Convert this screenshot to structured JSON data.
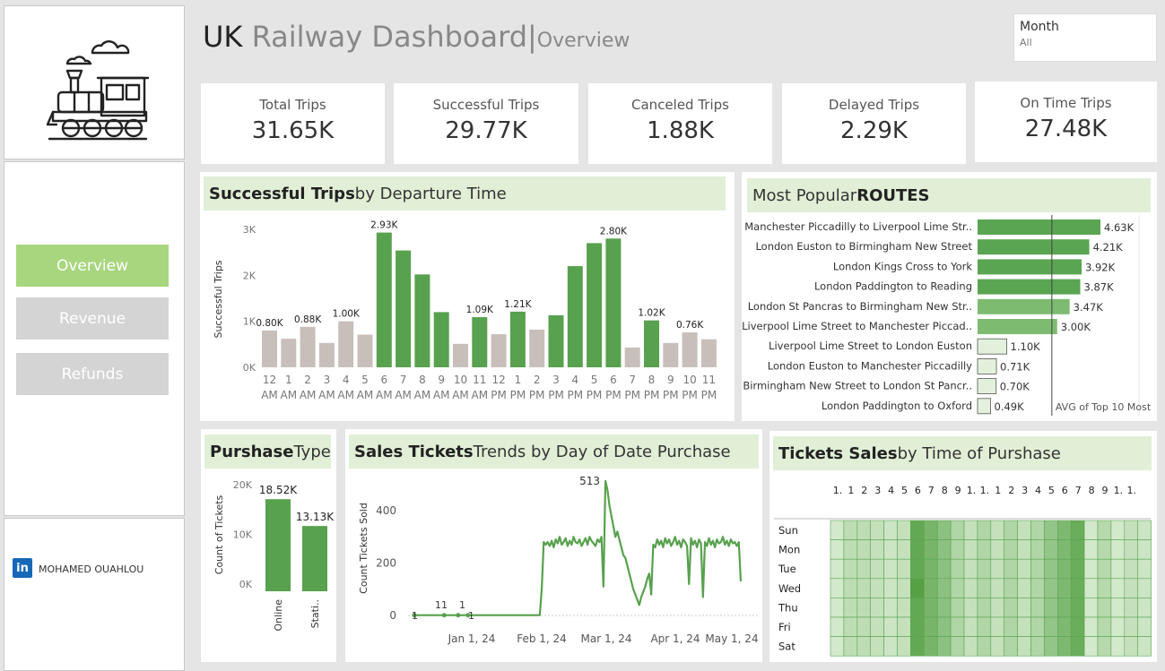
{
  "header": {
    "title_bold": "UK",
    "title_rest": " Railway Dashboard",
    "separator": "|",
    "subtitle": "Overview"
  },
  "filter": {
    "label": "Month",
    "value": "All"
  },
  "nav": [
    {
      "label": "Overview",
      "active": true
    },
    {
      "label": "Revenue",
      "active": false
    },
    {
      "label": "Refunds",
      "active": false
    }
  ],
  "credit": {
    "icon": "linkedin-icon",
    "icon_text": "in",
    "name": "MOHAMED OUAHLOU"
  },
  "kpis": [
    {
      "label": "Total Trips",
      "value": "31.65K"
    },
    {
      "label": "Successful Trips",
      "value": "29.77K"
    },
    {
      "label": "Canceled Trips",
      "value": "1.88K"
    },
    {
      "label": "Delayed Trips",
      "value": "2.29K"
    },
    {
      "label": "On Time Trips",
      "value": "27.48K"
    }
  ],
  "panels": {
    "departure": {
      "title_bold": "Successful Trips",
      "title_rest": " by Departure Time"
    },
    "routes": {
      "title_rest": "Most Popular ",
      "title_bold": "ROUTES"
    },
    "purchase_type": {
      "title_bold": "Purshase",
      "title_rest": " Type"
    },
    "sales_trend": {
      "title_bold": "Sales Tickets",
      "title_rest": " Trends by Day of Date Purchase"
    },
    "time_sales": {
      "title_bold": "Tickets Sales",
      "title_rest": " by Time of Purshase"
    }
  },
  "colors": {
    "accent": "#a8d67e",
    "bar_green": "#58a14e",
    "bar_gray": "#c8bfbb",
    "title_bg": "#e1efd6"
  },
  "chart_data": [
    {
      "id": "departure",
      "type": "bar",
      "ylabel": "Successful Trips",
      "ylim": [
        0,
        3200
      ],
      "yticks": [
        "0K",
        "1K",
        "2K",
        "3K"
      ],
      "categories": [
        "12 AM",
        "1 AM",
        "2 AM",
        "3 AM",
        "4 AM",
        "5 AM",
        "6 AM",
        "7 AM",
        "8 AM",
        "9 AM",
        "10 AM",
        "11 AM",
        "12 PM",
        "1 PM",
        "2 PM",
        "3 PM",
        "4 PM",
        "5 PM",
        "6 PM",
        "7 PM",
        "8 PM",
        "9 PM",
        "10 PM",
        "11 PM"
      ],
      "hour_labels": [
        "12",
        "1",
        "2",
        "3",
        "4",
        "5",
        "6",
        "7",
        "8",
        "9",
        "10",
        "11",
        "12",
        "1",
        "2",
        "3",
        "4",
        "5",
        "6",
        "7",
        "8",
        "9",
        "10",
        "11"
      ],
      "ampm_labels": [
        "AM",
        "AM",
        "AM",
        "AM",
        "AM",
        "AM",
        "AM",
        "AM",
        "AM",
        "AM",
        "AM",
        "AM",
        "PM",
        "PM",
        "PM",
        "PM",
        "PM",
        "PM",
        "PM",
        "PM",
        "PM",
        "PM",
        "PM",
        "PM"
      ],
      "values": [
        800,
        620,
        880,
        530,
        1000,
        710,
        2930,
        2540,
        2020,
        1200,
        510,
        1090,
        720,
        1210,
        820,
        1130,
        2200,
        2700,
        2800,
        430,
        1020,
        530,
        760,
        610
      ],
      "highlight": [
        false,
        false,
        false,
        false,
        false,
        false,
        true,
        true,
        true,
        true,
        false,
        true,
        false,
        true,
        false,
        true,
        true,
        true,
        true,
        false,
        true,
        false,
        false,
        false
      ],
      "data_labels": [
        "0.80K",
        "",
        "0.88K",
        "",
        "1.00K",
        "",
        "2.93K",
        "",
        "",
        "",
        "",
        "1.09K",
        "",
        "1.21K",
        "",
        "",
        "",
        "",
        "2.80K",
        "",
        "1.02K",
        "",
        "0.76K",
        ""
      ]
    },
    {
      "id": "routes",
      "type": "bar",
      "orientation": "horizontal",
      "categories": [
        "Manchester Piccadilly to Liverpool Lime Str..",
        "London Euston to Birmingham New Street",
        "London Kings Cross to York",
        "London Paddington to Reading",
        "London St Pancras to Birmingham New Str..",
        "Liverpool Lime Street to Manchester Piccad..",
        "Liverpool Lime Street to London Euston",
        "London Euston to Manchester Piccadilly",
        "Birmingham New Street to London St Pancr..",
        "London Paddington to Oxford"
      ],
      "values": [
        4630,
        4210,
        3920,
        3870,
        3470,
        3000,
        1100,
        710,
        700,
        490
      ],
      "data_labels": [
        "4.63K",
        "4.21K",
        "3.92K",
        "3.87K",
        "3.47K",
        "3.00K",
        "1.10K",
        "0.71K",
        "0.70K",
        "0.49K"
      ],
      "reference_line": {
        "label": "AVG of Top 10 Most",
        "value": 2800
      },
      "xlim": [
        0,
        5000
      ]
    },
    {
      "id": "purchase_type",
      "type": "bar",
      "ylabel": "Count of Tickets",
      "ylim": [
        0,
        21000
      ],
      "yticks": [
        "0K",
        "10K",
        "20K"
      ],
      "categories": [
        "Online",
        "Stati.."
      ],
      "values": [
        18520,
        13130
      ],
      "data_labels": [
        "18.52K",
        "13.13K"
      ]
    },
    {
      "id": "sales_trend",
      "type": "line",
      "ylabel": "Count Tickets Sold",
      "ylim": [
        0,
        550
      ],
      "yticks": [
        "0",
        "200",
        "400"
      ],
      "xticks": [
        "Jan 1, 24",
        "Feb 1, 24",
        "Mar 1, 24",
        "Apr 1, 24",
        "May 1, 24"
      ],
      "annotations": [
        "1",
        "11",
        "1",
        "1",
        "513"
      ],
      "series": [
        {
          "values": [
            1,
            1,
            1,
            1,
            1,
            1,
            1,
            1,
            1,
            1,
            1,
            1,
            1,
            1,
            1,
            1,
            1,
            1,
            1,
            1,
            1,
            1,
            1,
            1,
            1,
            1,
            1,
            1,
            1,
            1,
            1,
            1,
            1,
            1,
            1,
            1,
            1,
            1,
            1,
            1,
            1,
            1,
            1,
            1,
            1,
            1,
            1,
            1,
            1,
            1,
            1,
            1,
            1,
            1,
            1,
            1,
            1,
            1,
            1,
            1,
            1,
            1,
            1,
            1,
            100,
            280,
            270,
            280,
            265,
            285,
            260,
            290,
            275,
            300,
            270,
            280,
            295,
            265,
            285,
            270,
            300,
            280,
            275,
            290,
            265,
            280,
            295,
            270,
            300,
            285,
            275,
            265,
            290,
            280,
            300,
            110,
            513,
            480,
            420,
            380,
            340,
            300,
            320,
            290,
            260,
            230,
            220,
            190,
            160,
            130,
            100,
            80,
            60,
            40,
            70,
            90,
            110,
            140,
            160,
            80,
            270,
            260,
            290,
            270,
            285,
            260,
            295,
            275,
            290,
            265,
            280,
            300,
            270,
            285,
            260,
            290,
            280,
            265,
            120,
            295,
            270,
            285,
            260,
            290,
            275,
            70,
            280,
            265,
            295,
            270,
            285,
            260,
            290,
            275,
            280,
            300,
            270,
            285,
            265,
            290,
            275,
            280,
            265,
            280,
            130
          ]
        }
      ]
    },
    {
      "id": "time_sales",
      "type": "heatmap",
      "rows": [
        "Sun",
        "Mon",
        "Tue",
        "Wed",
        "Thu",
        "Fri",
        "Sat"
      ],
      "col_labels": [
        "1.",
        "1",
        "2",
        "3",
        "4",
        "5",
        "6",
        "7",
        "8",
        "9",
        "1.",
        "1.",
        "1",
        "2",
        "3",
        "4",
        "5",
        "6",
        "7",
        "8",
        "9",
        "1.",
        "1."
      ],
      "col_intensity": [
        0.1,
        0.25,
        0.25,
        0.2,
        0.15,
        0.2,
        0.9,
        0.75,
        0.6,
        0.35,
        0.2,
        0.35,
        0.2,
        0.35,
        0.2,
        0.35,
        0.55,
        0.7,
        0.85,
        0.1,
        0.3,
        0.1,
        0.2,
        0.15
      ]
    }
  ]
}
